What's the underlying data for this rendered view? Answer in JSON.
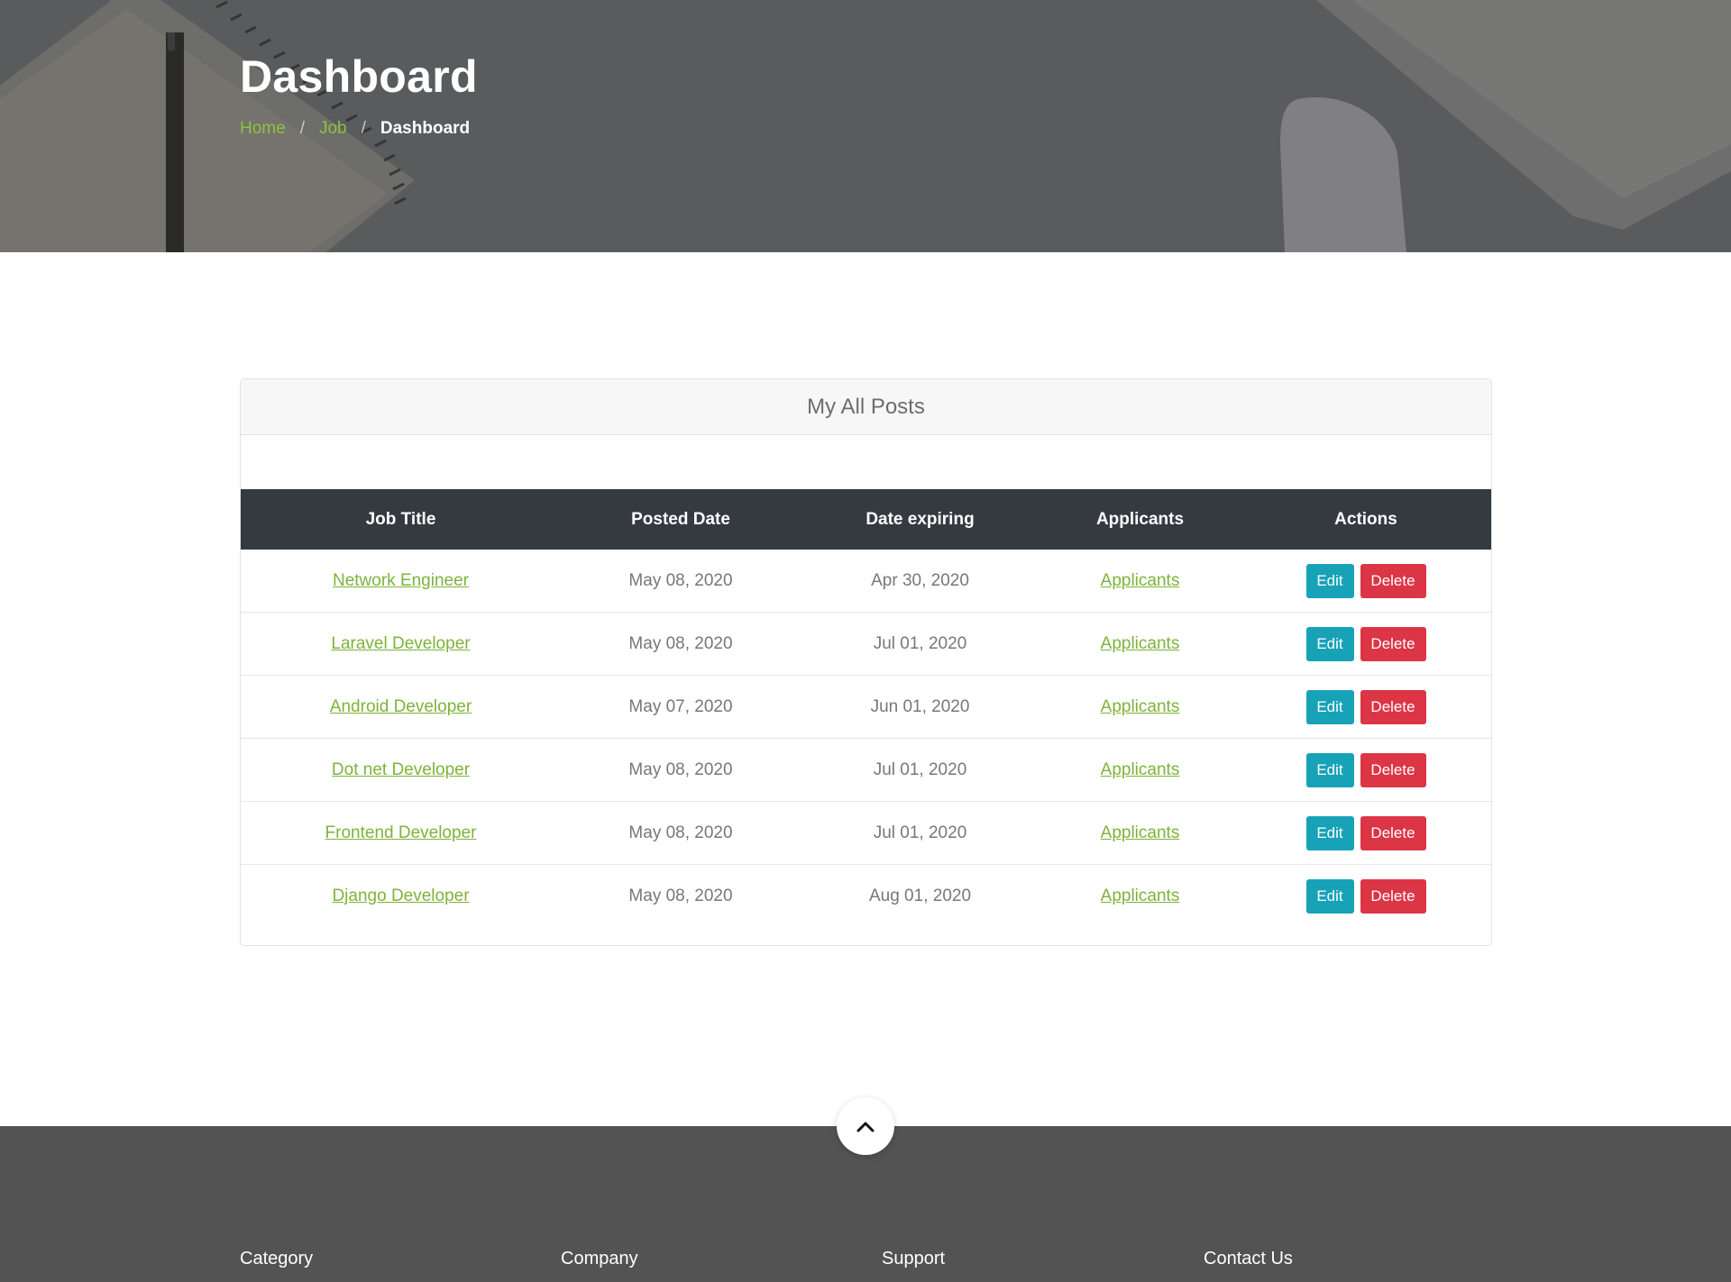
{
  "hero": {
    "title": "Dashboard",
    "breadcrumb": {
      "home": "Home",
      "job": "Job",
      "sep": "/",
      "current": "Dashboard"
    }
  },
  "posts": {
    "title": "My All Posts",
    "columns": [
      "Job Title",
      "Posted Date",
      "Date expiring",
      "Applicants",
      "Actions"
    ],
    "rows": [
      {
        "title": "Network Engineer",
        "posted": "May 08, 2020",
        "expires": "Apr 30, 2020",
        "applicants": "Applicants"
      },
      {
        "title": "Laravel Developer",
        "posted": "May 08, 2020",
        "expires": "Jul 01, 2020",
        "applicants": "Applicants"
      },
      {
        "title": "Android Developer",
        "posted": "May 07, 2020",
        "expires": "Jun 01, 2020",
        "applicants": "Applicants"
      },
      {
        "title": "Dot net Developer",
        "posted": "May 08, 2020",
        "expires": "Jul 01, 2020",
        "applicants": "Applicants"
      },
      {
        "title": "Frontend Developer",
        "posted": "May 08, 2020",
        "expires": "Jul 01, 2020",
        "applicants": "Applicants"
      },
      {
        "title": "Django Developer",
        "posted": "May 08, 2020",
        "expires": "Aug 01, 2020",
        "applicants": "Applicants"
      }
    ],
    "actions": {
      "edit": "Edit",
      "delete": "Delete"
    }
  },
  "footer": {
    "columns": [
      "Category",
      "Company",
      "Support",
      "Contact Us"
    ]
  },
  "icons": {
    "scroll_top": "chevron-up-icon"
  },
  "colors": {
    "accent": "#8ac43f",
    "table_header": "#343a40",
    "edit_button": "#17a2b8",
    "delete_button": "#dc3545",
    "footer": "#535353"
  }
}
